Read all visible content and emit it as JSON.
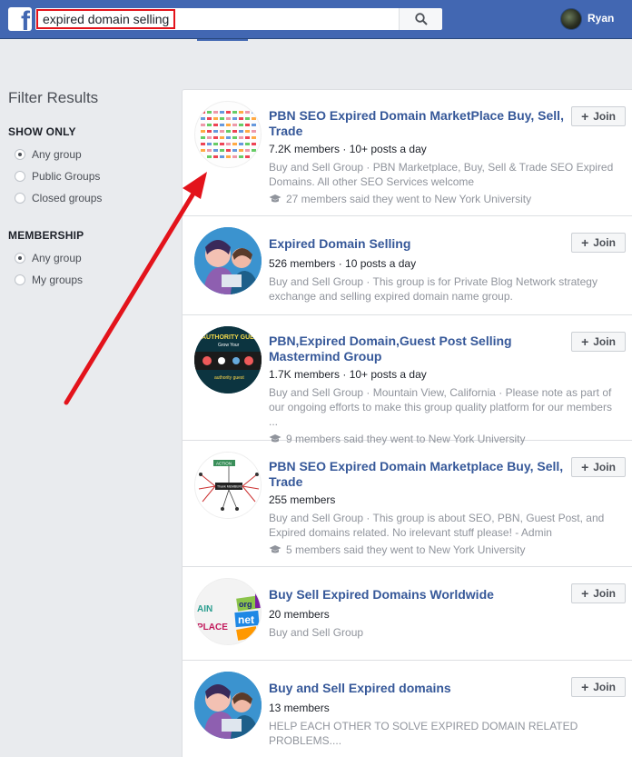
{
  "header": {
    "logo": "f",
    "search_value": "expired domain selling",
    "user_name": "Ryan"
  },
  "sidebar": {
    "title": "Filter Results",
    "show_only": {
      "label": "SHOW ONLY",
      "options": [
        {
          "label": "Any group",
          "checked": true
        },
        {
          "label": "Public Groups",
          "checked": false
        },
        {
          "label": "Closed groups",
          "checked": false
        }
      ]
    },
    "membership": {
      "label": "MEMBERSHIP",
      "options": [
        {
          "label": "Any group",
          "checked": true
        },
        {
          "label": "My groups",
          "checked": false
        }
      ]
    }
  },
  "join_label": "Join",
  "results": [
    {
      "title": "PBN SEO Expired Domain MarketPlace Buy, Sell, Trade",
      "members": "7.2K members · 10+ posts a day",
      "description": "Buy and Sell Group · PBN Marketplace, Buy, Sell & Trade SEO Expired Domains. All other SEO Services welcome",
      "university": "27 members said they went to New York University"
    },
    {
      "title": "Expired Domain Selling",
      "members": "526 members · 10 posts a day",
      "description": "Buy and Sell Group · This group is for Private Blog Network strategy exchange and selling expired domain name group.",
      "university": ""
    },
    {
      "title": "PBN,Expired Domain,Guest Post Selling Mastermind Group",
      "members": "1.7K members · 10+ posts a day",
      "description": "Buy and Sell Group · Mountain View, California · Please note as part of our ongoing efforts to make this group quality platform for our members ...",
      "university": "9 members said they went to New York University"
    },
    {
      "title": "PBN SEO Expired Domain Marketplace Buy, Sell, Trade",
      "members": "255 members",
      "description": "Buy and Sell Group · This group is about SEO, PBN, Guest Post, and Expired domains related. No irelevant stuff please! - Admin",
      "university": "5 members said they went to New York University"
    },
    {
      "title": "Buy Sell Expired Domains Worldwide",
      "members": "20 members",
      "description": "Buy and Sell Group",
      "university": ""
    },
    {
      "title": "Buy and Sell Expired domains",
      "members": "13 members",
      "description": "HELP EACH OTHER TO SOLVE EXPIRED DOMAIN RELATED PROBLEMS....",
      "university": ""
    }
  ],
  "thumbnails": {
    "thumb_3_text": [
      "AUTHORITY GUE",
      "Grow Your",
      "authority guest"
    ],
    "thumb_4_text": [
      "ACTION",
      "Thank MEMBERSHIP"
    ],
    "thumb_5_text": [
      "AIN",
      "PLACE",
      "net",
      "org"
    ]
  },
  "colors": {
    "brand_blue": "#4267b2",
    "link_blue": "#365899",
    "annotation_red": "#e3131b"
  }
}
